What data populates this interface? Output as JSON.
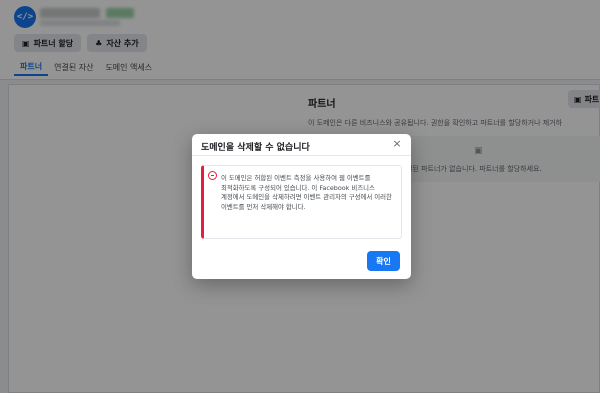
{
  "header": {
    "avatar_glyph": "</>",
    "buttons": [
      {
        "icon": "briefcase-icon",
        "glyph": "▣",
        "label": "파트너 할당"
      },
      {
        "icon": "shapes-icon",
        "glyph": "♣",
        "label": "자산 추가"
      }
    ],
    "tabs": [
      {
        "label": "파트너",
        "active": true
      },
      {
        "label": "연결된 자산",
        "active": false
      },
      {
        "label": "도메인 액세스",
        "active": false
      }
    ]
  },
  "content": {
    "title": "파트너",
    "description": "이 도메인은 다른 비즈니스와 공유됩니다. 권한을 확인하고 파트너를 할당하거나 제거하",
    "right_button_label": "파트",
    "empty_text": "결된 파트너가 없습니다. 파트너를 할당하세요."
  },
  "modal": {
    "title": "도메인을 삭제할 수 없습니다",
    "close_glyph": "×",
    "alert_text": "이 도메인은 허합된 이벤트 측정을 사용하여 웹 이벤트를 최적화하도록 구성되어 있습니다. 이 Facebook 비즈니스 계정에서 도메인을 삭제하려면 이벤트 관리자의 구성에서 이러한 이벤트를 먼저 삭제해야 합니다.",
    "confirm_label": "확인"
  },
  "colors": {
    "accent": "#1877f2",
    "error": "#e41e3f"
  }
}
